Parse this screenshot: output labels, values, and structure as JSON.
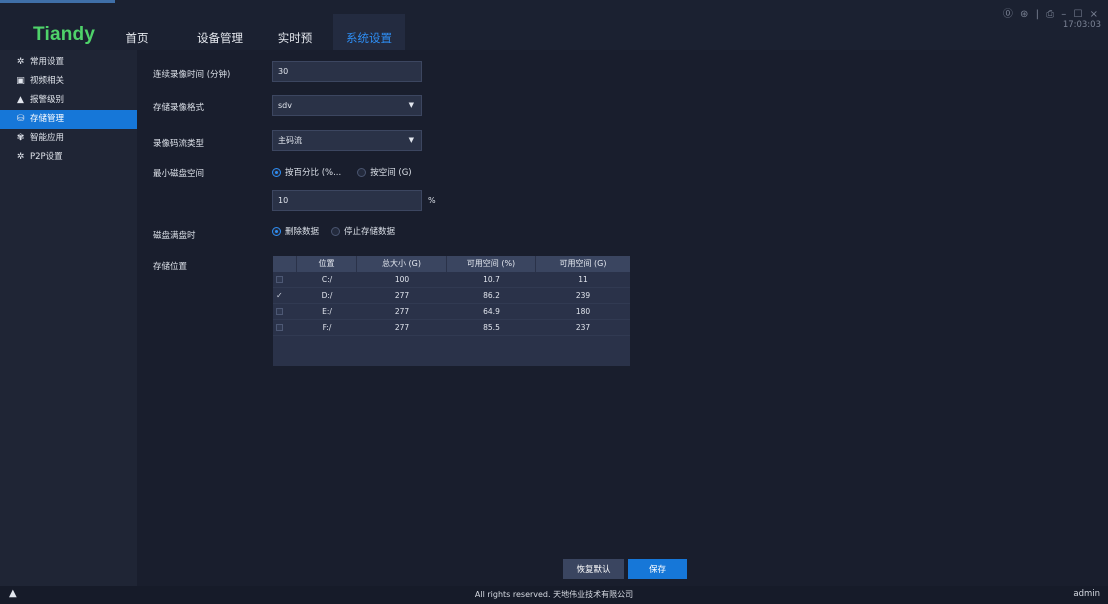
{
  "header": {
    "logo": "Tiandy",
    "nav": [
      {
        "label": "首页"
      },
      {
        "label": "设备管理"
      },
      {
        "label": "实时预览"
      },
      {
        "label": "系统设置"
      }
    ],
    "active_nav": "系统设置",
    "window_controls": "⓪ ⊛ | ⎙ – ☐ ×",
    "time": "17:03:03"
  },
  "sidebar": {
    "items": [
      {
        "label": "常用设置",
        "icon": "gear-icon",
        "glyph": "✲"
      },
      {
        "label": "视频相关",
        "icon": "video-icon",
        "glyph": "▣"
      },
      {
        "label": "报警级别",
        "icon": "warning-icon",
        "glyph": "▲"
      },
      {
        "label": "存储管理",
        "icon": "storage-icon",
        "glyph": "⛁"
      },
      {
        "label": "智能应用",
        "icon": "smart-app-icon",
        "glyph": "✾"
      },
      {
        "label": "P2P设置",
        "icon": "p2p-icon",
        "glyph": "✲"
      }
    ],
    "active": "存储管理"
  },
  "form": {
    "record_time_label": "连续录像时间 (分钟)",
    "record_time_value": "30",
    "format_label": "存储录像格式",
    "format_value": "sdv",
    "stream_label": "录像码流类型",
    "stream_value": "主码流",
    "min_space_label": "最小磁盘空间",
    "min_space_opt_percent": "按百分比 (%...",
    "min_space_opt_space": "按空间 (G)",
    "min_space_selected": "percent",
    "min_space_value": "10",
    "min_space_unit": "%",
    "disk_full_label": "磁盘满盘时",
    "disk_full_opt_delete": "删除数据",
    "disk_full_opt_stop": "停止存储数据",
    "disk_full_selected": "delete",
    "location_label": "存储位置"
  },
  "table": {
    "columns": [
      "",
      "位置",
      "总大小 (G)",
      "可用空间 (%)",
      "可用空间 (G)"
    ],
    "rows": [
      {
        "checked": false,
        "location": "C:/",
        "total": "100",
        "free_pct": "10.7",
        "free_g": "11"
      },
      {
        "checked": true,
        "location": "D:/",
        "total": "277",
        "free_pct": "86.2",
        "free_g": "239"
      },
      {
        "checked": false,
        "location": "E:/",
        "total": "277",
        "free_pct": "64.9",
        "free_g": "180"
      },
      {
        "checked": false,
        "location": "F:/",
        "total": "277",
        "free_pct": "85.5",
        "free_g": "237"
      }
    ]
  },
  "buttons": {
    "restore": "恢复默认",
    "save": "保存"
  },
  "footer": {
    "copyright": "All rights reserved. 天地伟业技术有限公司",
    "user": "admin",
    "warning_glyph": "▲"
  },
  "colors": {
    "accent": "#1677d8",
    "logo": "#4fd36a",
    "background": "#191e2d"
  }
}
